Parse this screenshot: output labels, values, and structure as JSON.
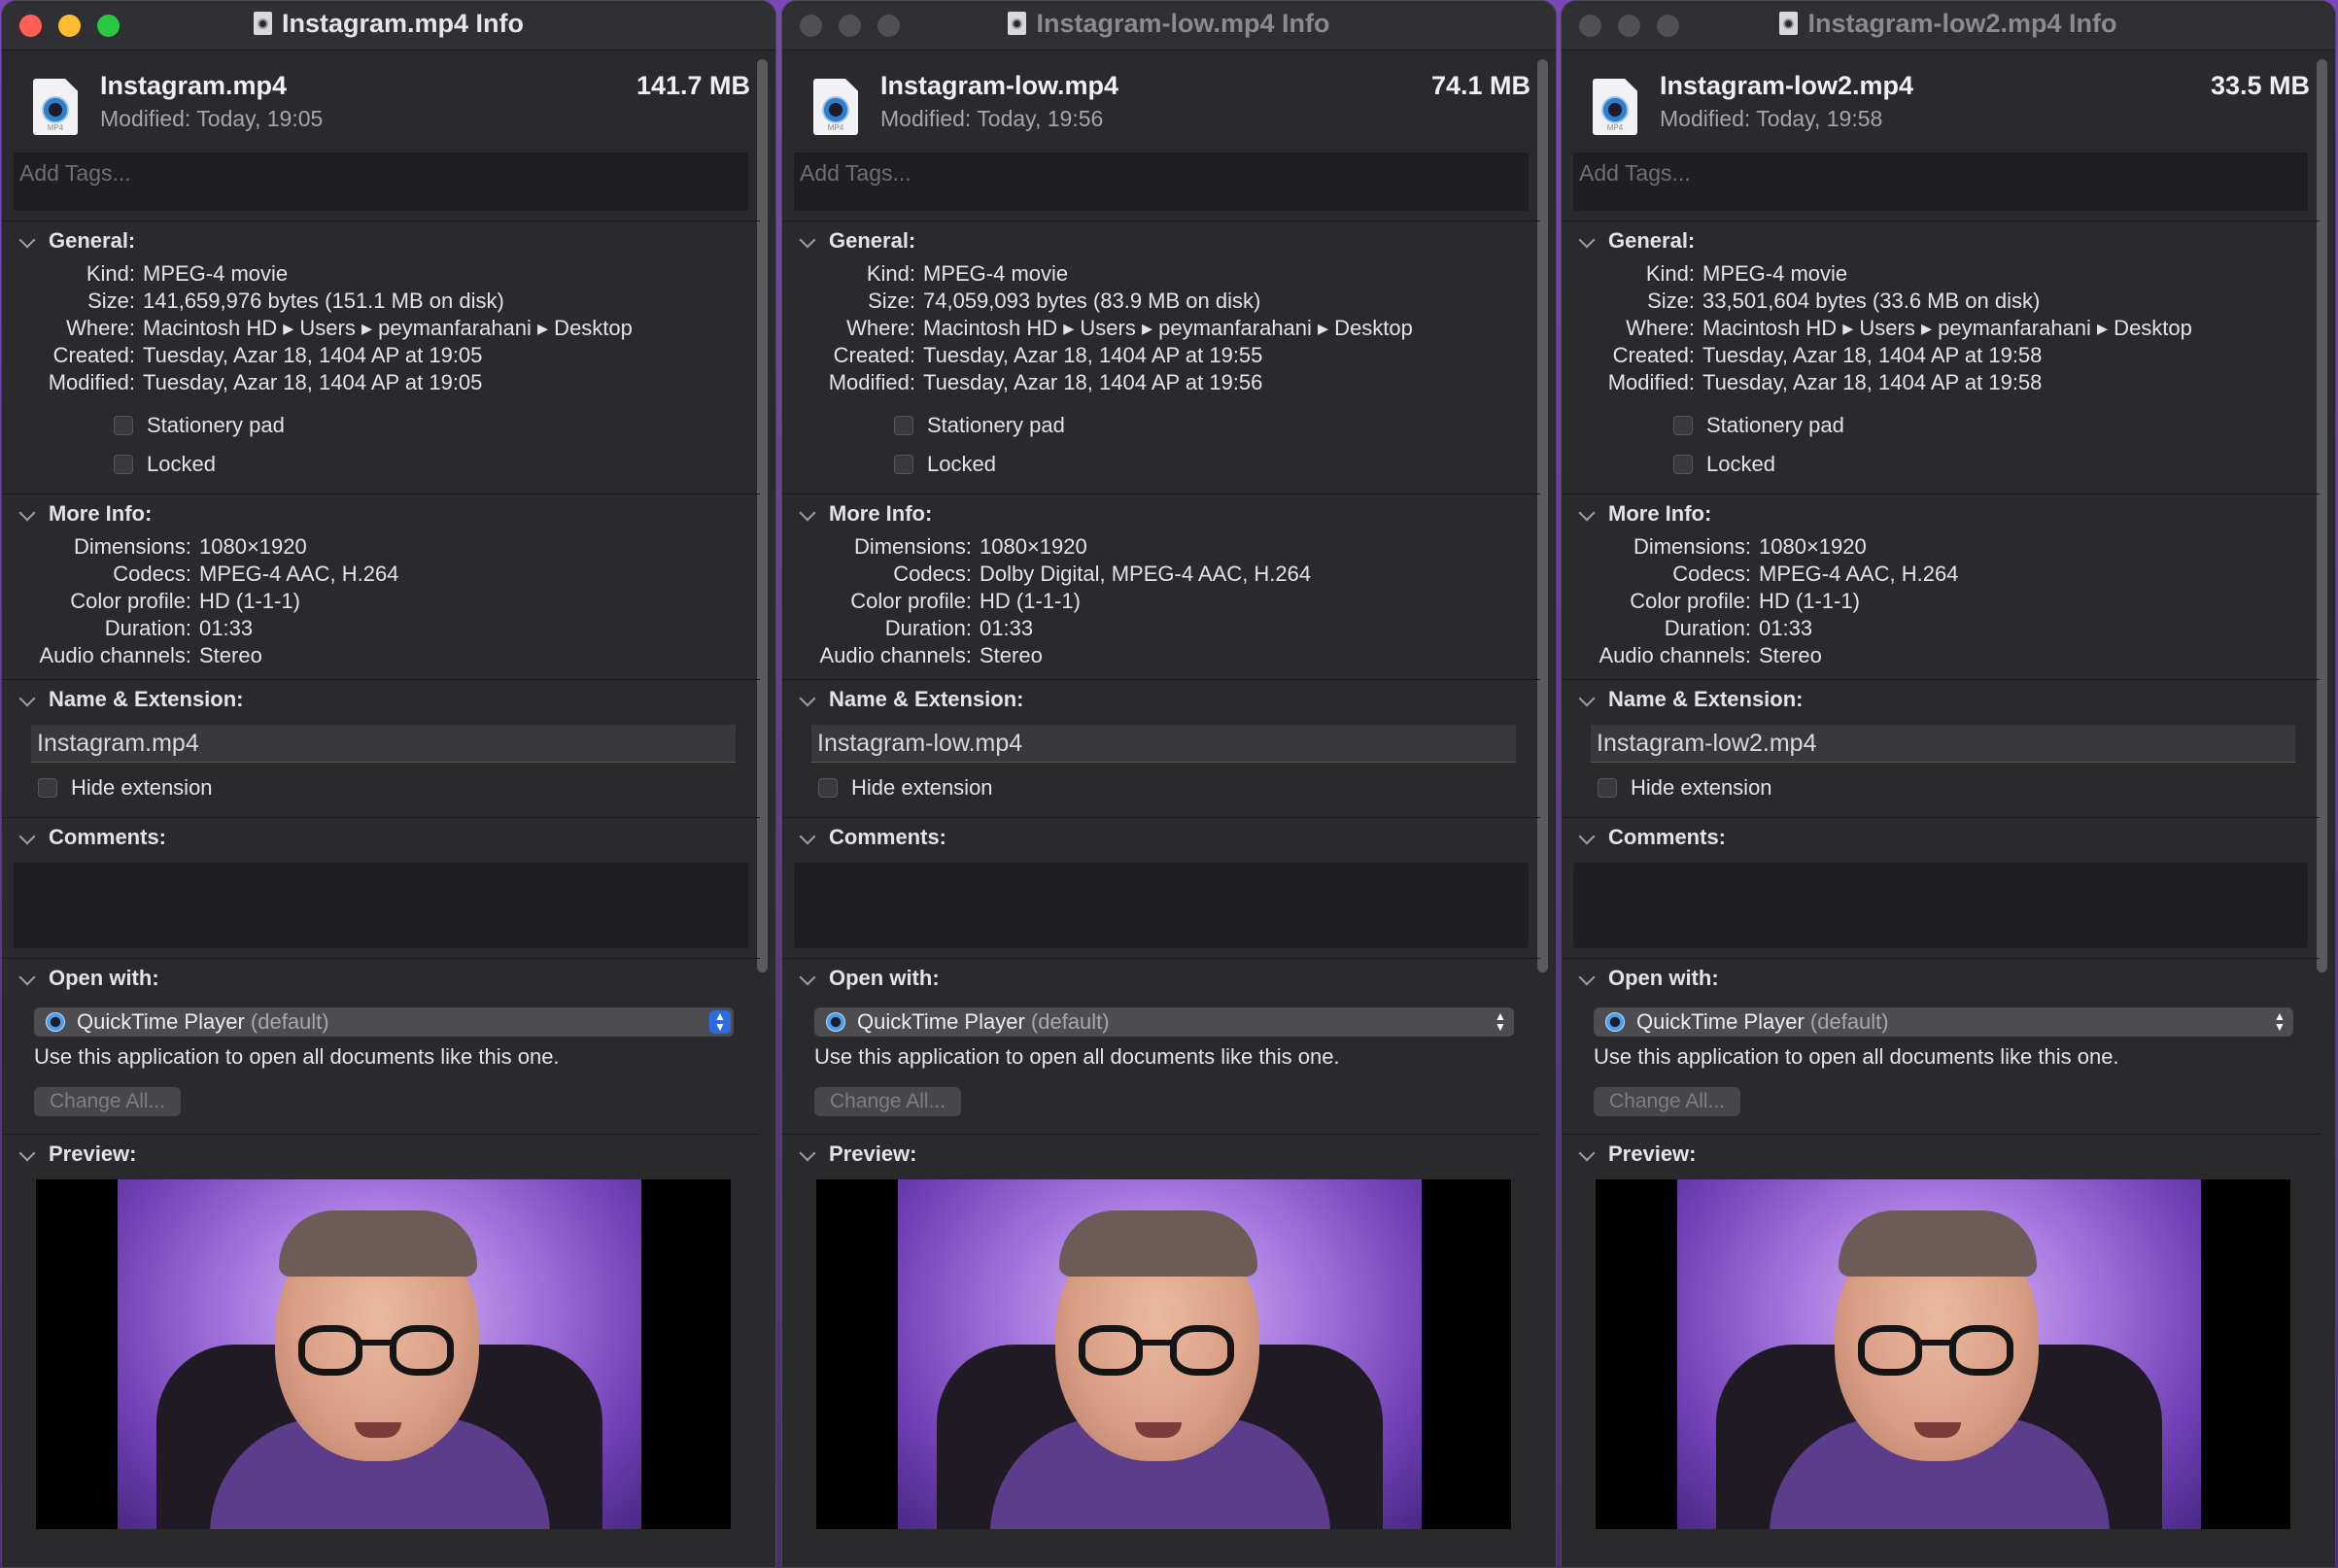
{
  "windows": [
    {
      "title": "Instagram.mp4 Info",
      "file_name": "Instagram.mp4",
      "modified_summary": "Modified: Today, 19:05",
      "size_summary": "141.7 MB",
      "tags_placeholder": "Add Tags...",
      "general_header": "General:",
      "general": [
        {
          "label": "Kind:",
          "value": "MPEG-4 movie"
        },
        {
          "label": "Size:",
          "value": "141,659,976 bytes (151.1 MB on disk)"
        },
        {
          "label": "Where:",
          "value": "Macintosh HD ▸ Users ▸ peymanfarahani ▸ Desktop"
        },
        {
          "label": "Created:",
          "value": "Tuesday, Azar 18, 1404 AP at 19:05"
        },
        {
          "label": "Modified:",
          "value": "Tuesday, Azar 18, 1404 AP at 19:05"
        }
      ],
      "stationery_label": "Stationery pad",
      "locked_label": "Locked",
      "more_header": "More Info:",
      "more": [
        {
          "label": "Dimensions:",
          "value": "1080×1920"
        },
        {
          "label": "Codecs:",
          "value": "MPEG-4 AAC, H.264"
        },
        {
          "label": "Color profile:",
          "value": "HD (1-1-1)"
        },
        {
          "label": "Duration:",
          "value": "01:33"
        },
        {
          "label": "Audio channels:",
          "value": "Stereo"
        }
      ],
      "name_header": "Name & Extension:",
      "name_value": "Instagram.mp4",
      "hide_ext_label": "Hide extension",
      "comments_header": "Comments:",
      "open_header": "Open with:",
      "app_name": "QuickTime Player",
      "app_default": "(default)",
      "use_text": "Use this application to open all documents like this one.",
      "change_all": "Change All...",
      "preview_header": "Preview:"
    },
    {
      "title": "Instagram-low.mp4 Info",
      "file_name": "Instagram-low.mp4",
      "modified_summary": "Modified: Today, 19:56",
      "size_summary": "74.1 MB",
      "tags_placeholder": "Add Tags...",
      "general_header": "General:",
      "general": [
        {
          "label": "Kind:",
          "value": "MPEG-4 movie"
        },
        {
          "label": "Size:",
          "value": "74,059,093 bytes (83.9 MB on disk)"
        },
        {
          "label": "Where:",
          "value": "Macintosh HD ▸ Users ▸ peymanfarahani ▸ Desktop"
        },
        {
          "label": "Created:",
          "value": "Tuesday, Azar 18, 1404 AP at 19:55"
        },
        {
          "label": "Modified:",
          "value": "Tuesday, Azar 18, 1404 AP at 19:56"
        }
      ],
      "stationery_label": "Stationery pad",
      "locked_label": "Locked",
      "more_header": "More Info:",
      "more": [
        {
          "label": "Dimensions:",
          "value": "1080×1920"
        },
        {
          "label": "Codecs:",
          "value": "Dolby Digital, MPEG-4 AAC, H.264"
        },
        {
          "label": "Color profile:",
          "value": "HD (1-1-1)"
        },
        {
          "label": "Duration:",
          "value": "01:33"
        },
        {
          "label": "Audio channels:",
          "value": "Stereo"
        }
      ],
      "name_header": "Name & Extension:",
      "name_value": "Instagram-low.mp4",
      "hide_ext_label": "Hide extension",
      "comments_header": "Comments:",
      "open_header": "Open with:",
      "app_name": "QuickTime Player",
      "app_default": "(default)",
      "use_text": "Use this application to open all documents like this one.",
      "change_all": "Change All...",
      "preview_header": "Preview:"
    },
    {
      "title": "Instagram-low2.mp4 Info",
      "file_name": "Instagram-low2.mp4",
      "modified_summary": "Modified: Today, 19:58",
      "size_summary": "33.5 MB",
      "tags_placeholder": "Add Tags...",
      "general_header": "General:",
      "general": [
        {
          "label": "Kind:",
          "value": "MPEG-4 movie"
        },
        {
          "label": "Size:",
          "value": "33,501,604 bytes (33.6 MB on disk)"
        },
        {
          "label": "Where:",
          "value": "Macintosh HD ▸ Users ▸ peymanfarahani ▸ Desktop"
        },
        {
          "label": "Created:",
          "value": "Tuesday, Azar 18, 1404 AP at 19:58"
        },
        {
          "label": "Modified:",
          "value": "Tuesday, Azar 18, 1404 AP at 19:58"
        }
      ],
      "stationery_label": "Stationery pad",
      "locked_label": "Locked",
      "more_header": "More Info:",
      "more": [
        {
          "label": "Dimensions:",
          "value": "1080×1920"
        },
        {
          "label": "Codecs:",
          "value": "MPEG-4 AAC, H.264"
        },
        {
          "label": "Color profile:",
          "value": "HD (1-1-1)"
        },
        {
          "label": "Duration:",
          "value": "01:33"
        },
        {
          "label": "Audio channels:",
          "value": "Stereo"
        }
      ],
      "name_header": "Name & Extension:",
      "name_value": "Instagram-low2.mp4",
      "hide_ext_label": "Hide extension",
      "comments_header": "Comments:",
      "open_header": "Open with:",
      "app_name": "QuickTime Player",
      "app_default": "(default)",
      "use_text": "Use this application to open all documents like this one.",
      "change_all": "Change All...",
      "preview_header": "Preview:"
    }
  ],
  "icons": {
    "file": "mp4-document-icon",
    "app": "quicktime-icon",
    "disclosure": "chevron-down-icon",
    "popup": "up-down-arrows-icon"
  },
  "colors": {
    "window_bg": "#2a2a2d",
    "close": "#fe5f57",
    "minimize": "#febc2e",
    "zoom": "#28c840",
    "popup_accent": "#2d6ce0"
  }
}
